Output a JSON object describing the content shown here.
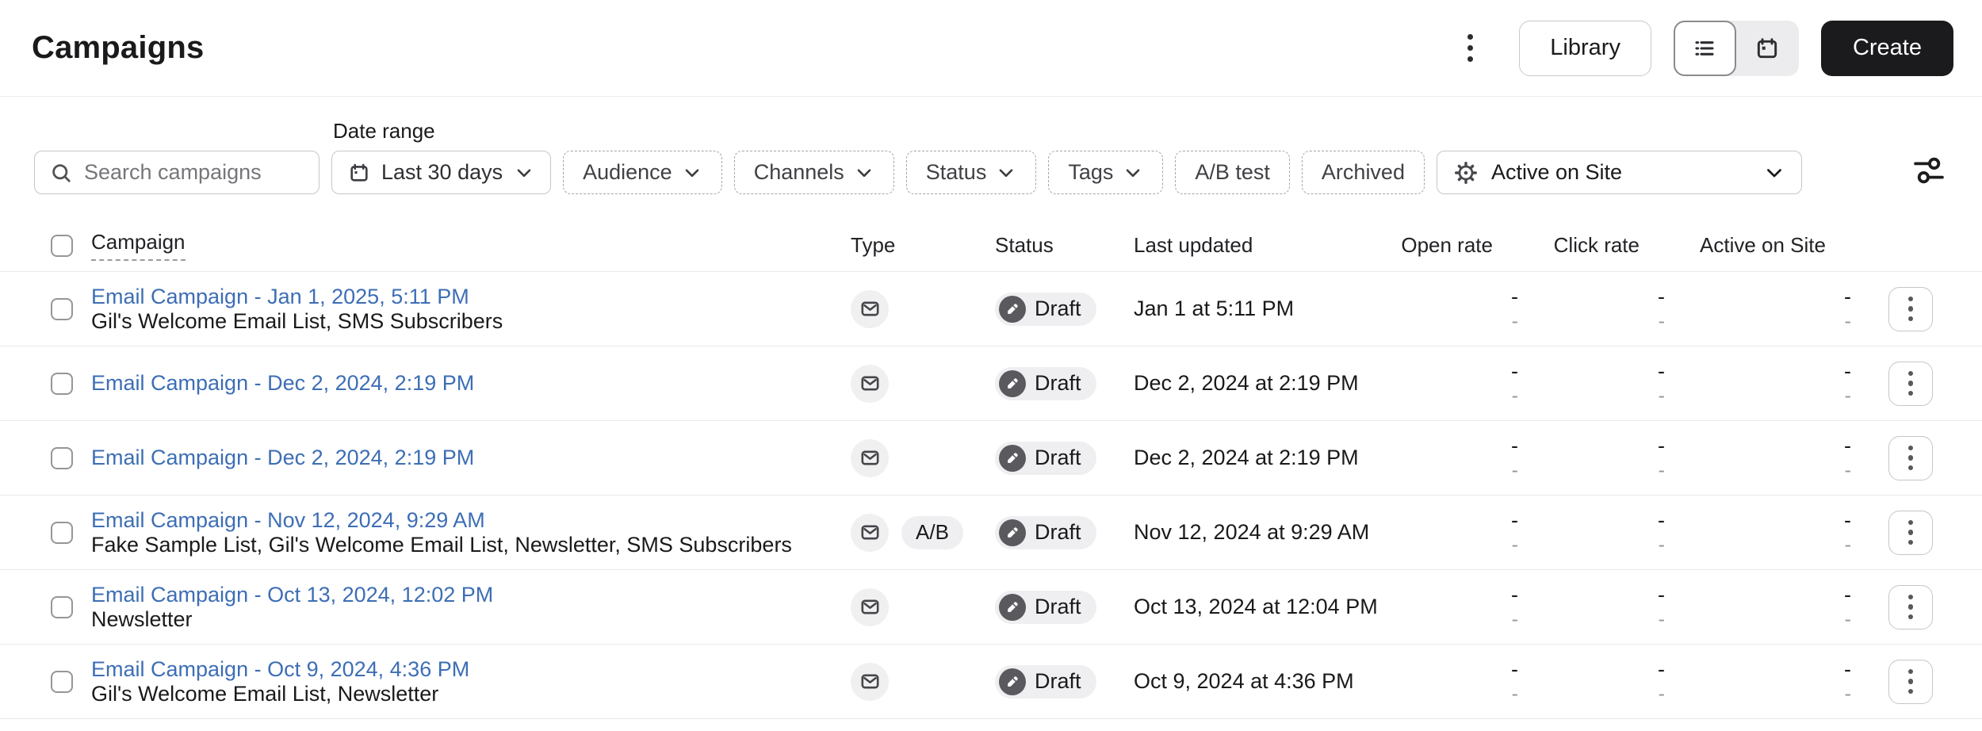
{
  "page": {
    "title": "Campaigns"
  },
  "header": {
    "overflow_menu_icon": "kebab-vertical-icon",
    "library_button": "Library",
    "view_toggle": {
      "options": [
        "list",
        "calendar"
      ],
      "selected": "list"
    },
    "create_button": "Create"
  },
  "filters": {
    "search": {
      "placeholder": "Search campaigns",
      "value": ""
    },
    "date_range": {
      "label": "Date range",
      "value": "Last 30 days"
    },
    "audience": "Audience",
    "channels": "Channels",
    "status": "Status",
    "tags": "Tags",
    "ab_test": "A/B test",
    "archived": "Archived",
    "active_on_site": "Active on Site"
  },
  "table": {
    "headers": {
      "campaign": "Campaign",
      "type": "Type",
      "status": "Status",
      "last_updated": "Last updated",
      "open_rate": "Open rate",
      "click_rate": "Click rate",
      "active_on_site": "Active on Site"
    },
    "rows": [
      {
        "title": "Email Campaign - Jan 1, 2025, 5:11 PM",
        "subtitle": "Gil's Welcome Email List, SMS Subscribers",
        "type": "email",
        "status": "Draft",
        "last_updated": "Jan 1 at 5:11 PM",
        "open_rate": "-",
        "open_rate_secondary": "-",
        "click_rate": "-",
        "click_rate_secondary": "-",
        "active_on_site": "-",
        "active_on_site_secondary": "-"
      },
      {
        "title": "Email Campaign - Dec 2, 2024, 2:19 PM",
        "subtitle": "",
        "type": "email",
        "status": "Draft",
        "last_updated": "Dec 2, 2024 at 2:19 PM",
        "open_rate": "-",
        "open_rate_secondary": "-",
        "click_rate": "-",
        "click_rate_secondary": "-",
        "active_on_site": "-",
        "active_on_site_secondary": "-"
      },
      {
        "title": "Email Campaign - Dec 2, 2024, 2:19 PM",
        "subtitle": "",
        "type": "email",
        "status": "Draft",
        "last_updated": "Dec 2, 2024 at 2:19 PM",
        "open_rate": "-",
        "open_rate_secondary": "-",
        "click_rate": "-",
        "click_rate_secondary": "-",
        "active_on_site": "-",
        "active_on_site_secondary": "-"
      },
      {
        "title": "Email Campaign - Nov 12, 2024, 9:29 AM",
        "subtitle": "Fake Sample List, Gil's Welcome Email List, Newsletter, SMS Subscribers",
        "type": "email",
        "ab_badge": "A/B",
        "status": "Draft",
        "last_updated": "Nov 12, 2024 at 9:29 AM",
        "open_rate": "-",
        "open_rate_secondary": "-",
        "click_rate": "-",
        "click_rate_secondary": "-",
        "active_on_site": "-",
        "active_on_site_secondary": "-"
      },
      {
        "title": "Email Campaign - Oct 13, 2024, 12:02 PM",
        "subtitle": "Newsletter",
        "type": "email",
        "status": "Draft",
        "last_updated": "Oct 13, 2024 at 12:04 PM",
        "open_rate": "-",
        "open_rate_secondary": "-",
        "click_rate": "-",
        "click_rate_secondary": "-",
        "active_on_site": "-",
        "active_on_site_secondary": "-"
      },
      {
        "title": "Email Campaign - Oct 9, 2024, 4:36 PM",
        "subtitle": "Gil's Welcome Email List, Newsletter",
        "type": "email",
        "status": "Draft",
        "last_updated": "Oct 9, 2024 at 4:36 PM",
        "open_rate": "-",
        "open_rate_secondary": "-",
        "click_rate": "-",
        "click_rate_secondary": "-",
        "active_on_site": "-",
        "active_on_site_secondary": "-"
      }
    ]
  },
  "colors": {
    "link_blue": "#3d6eb5",
    "create_button_bg": "#1b1b1d",
    "badge_bg": "#efeff1",
    "status_icon_bg": "#59595e",
    "row_separator": "#e9e9eb",
    "dashed_filter_border": "#a6a6aa",
    "secondary_metric": "#97979b"
  }
}
